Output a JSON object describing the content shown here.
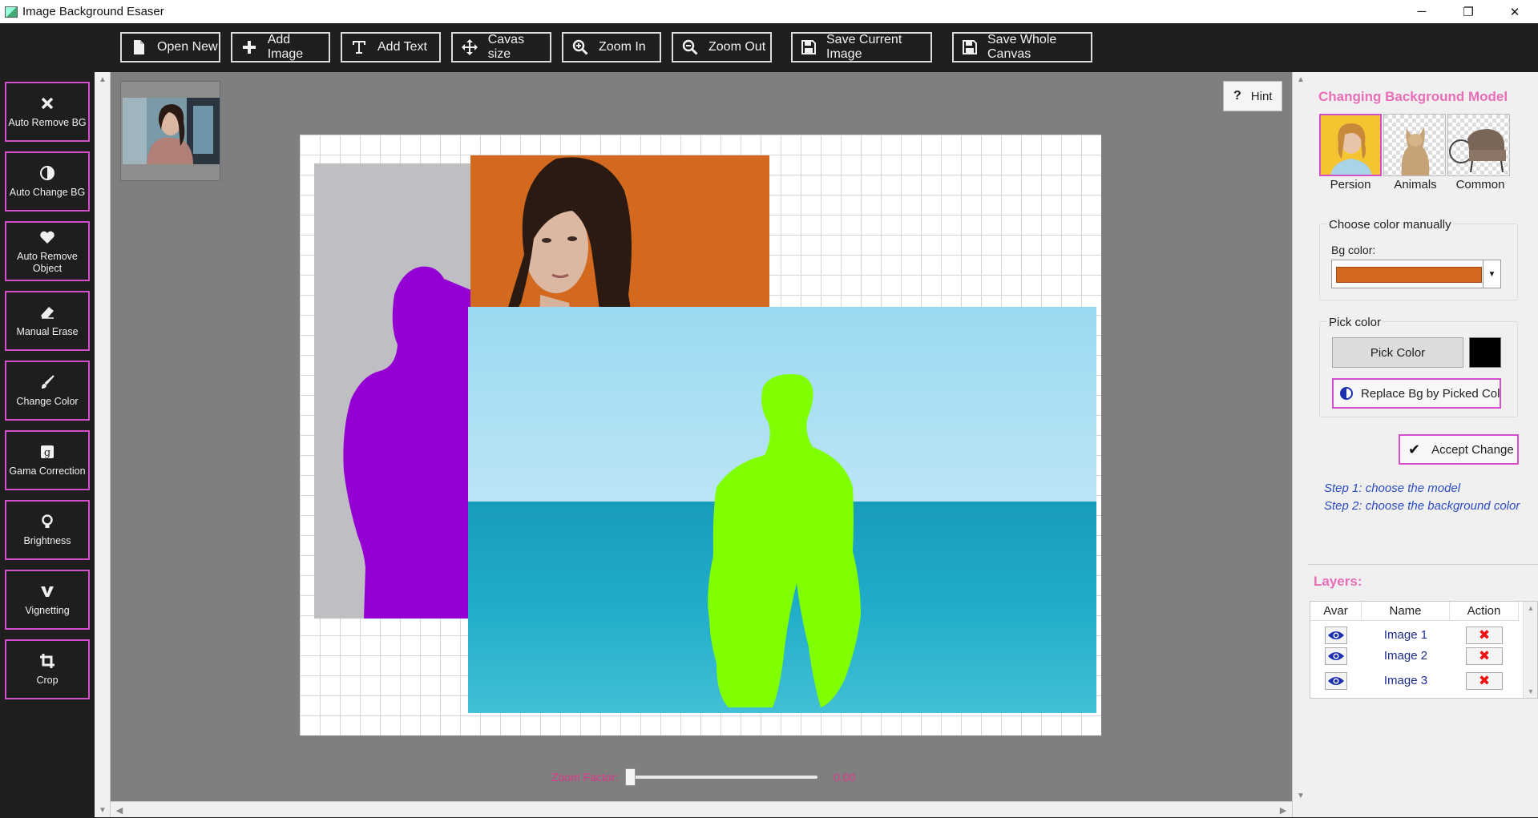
{
  "window": {
    "title": "Image Background Esaser",
    "controls": [
      "─",
      "❐",
      "✕"
    ]
  },
  "toolbar": {
    "buttons": [
      {
        "label": "Open New",
        "icon": "file-icon"
      },
      {
        "label": "Add Image",
        "icon": "plus-icon"
      },
      {
        "label": "Add Text",
        "icon": "text-icon"
      },
      {
        "label": "Cavas size",
        "icon": "move-icon"
      },
      {
        "label": "Zoom In",
        "icon": "zoom-in-icon"
      },
      {
        "label": "Zoom Out",
        "icon": "zoom-out-icon"
      },
      {
        "label": "Save Current Image",
        "icon": "save-icon"
      },
      {
        "label": "Save Whole Canvas",
        "icon": "save-icon"
      }
    ]
  },
  "sidebar": {
    "tools": [
      {
        "label": "Auto Remove BG",
        "icon": "x-icon"
      },
      {
        "label": "Auto Change BG",
        "icon": "contrast-icon"
      },
      {
        "label": "Auto Remove Object",
        "icon": "heart-icon"
      },
      {
        "label": "Manual Erase",
        "icon": "eraser-icon"
      },
      {
        "label": "Change Color",
        "icon": "brush-icon"
      },
      {
        "label": "Gama Correction",
        "icon": "gamma-icon"
      },
      {
        "label": "Brightness",
        "icon": "bulb-icon"
      },
      {
        "label": "Vignetting",
        "icon": "vignette-icon"
      },
      {
        "label": "Crop",
        "icon": "crop-icon"
      }
    ]
  },
  "canvas": {
    "hint_label": "Hint",
    "zoom_label": "Zoom Factor:",
    "zoom_value": "0.00",
    "zoom_fraction": 0.0
  },
  "right_panel": {
    "title": "Changing Background Model",
    "models": [
      {
        "label": "Persion",
        "selected": true
      },
      {
        "label": "Animals",
        "selected": false
      },
      {
        "label": "Common",
        "selected": false
      }
    ],
    "manual_group_title": "Choose color manually",
    "bg_color_label": "Bg color:",
    "bg_color_value": "#d2691e",
    "pick_group_title": "Pick color",
    "pick_button": "Pick Color",
    "picked_color": "#000000",
    "replace_button": "Replace Bg by Picked Color",
    "accept_button": "Accept Change",
    "steps": [
      "Step 1: choose the model",
      "Step 2: choose the background color"
    ],
    "layers_title": "Layers:",
    "layers_columns": [
      "Avar",
      "Name",
      "Action"
    ],
    "layers": [
      {
        "name": "Image 1"
      },
      {
        "name": "Image 2"
      },
      {
        "name": "Image 3"
      }
    ]
  },
  "colors": {
    "accent_pink": "#d64ec9",
    "title_pink": "#e96db7",
    "zoom_pink": "#e0358c",
    "step_blue": "#2b4bc4",
    "purple_silhouette": "#9400d3",
    "green_silhouette": "#7fff00",
    "orange_bg": "#d2691e"
  }
}
